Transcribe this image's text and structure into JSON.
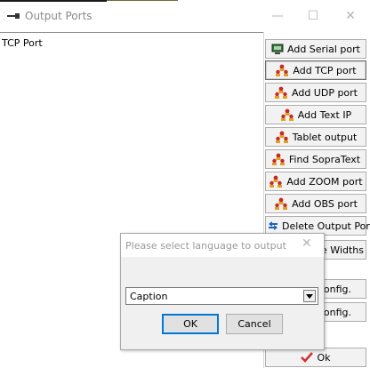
{
  "window": {
    "title": "Output Ports",
    "minimize_glyph": "—",
    "maximize_glyph": "☐",
    "close_glyph": "✕"
  },
  "ports_list": {
    "items": [
      "TCP Port"
    ]
  },
  "buttons": {
    "add_serial": "Add Serial port",
    "add_tcp": "Add TCP port",
    "add_udp": "Add UDP port",
    "add_text_ip": "Add Text IP",
    "tablet_output": "Tablet output",
    "find_sopratext": "Find SopraText",
    "add_zoom": "Add ZOOM port",
    "add_obs": "Add OBS port",
    "delete_output": "Delete Output Port",
    "column_widths": "re Widths",
    "config_1": "Config.",
    "config_2": "Config.",
    "ok": "Ok"
  },
  "dialog": {
    "title": "Please select language to output",
    "close_glyph": "✕",
    "language_value": "Caption",
    "ok_label": "OK",
    "cancel_label": "Cancel"
  },
  "icons": {
    "serial": "monitor-icon",
    "network": "network-people-icon",
    "delete": "arrows-icon",
    "ok": "checkmark-icon"
  },
  "colors": {
    "network_icon_red": "#c62828",
    "network_icon_gold": "#e0a020",
    "ok_check": "#d32f2f",
    "focus_border": "#0078d7"
  }
}
